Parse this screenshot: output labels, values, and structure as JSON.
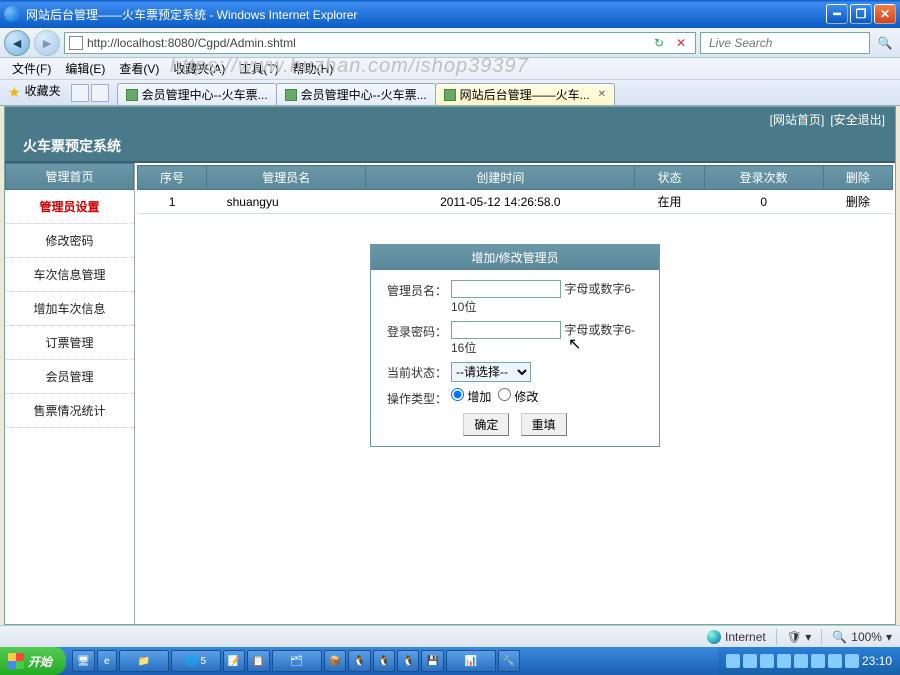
{
  "window": {
    "title": "网站后台管理——火车票预定系统 - Windows Internet Explorer"
  },
  "nav": {
    "url": "http://localhost:8080/Cgpd/Admin.shtml",
    "search_placeholder": "Live Search"
  },
  "menu": {
    "file": "文件(F)",
    "edit": "编辑(E)",
    "view": "查看(V)",
    "favorites": "收藏夹(A)",
    "tools": "工具(T)",
    "help": "帮助(H)"
  },
  "watermark": "https://www.huzhan.com/ishop39397",
  "favorites_label": "收藏夹",
  "tabs": [
    {
      "label": "会员管理中心--火车票..."
    },
    {
      "label": "会员管理中心--火车票..."
    },
    {
      "label": "网站后台管理——火车...",
      "active": true
    }
  ],
  "topbar": {
    "home": "[网站首页]",
    "logout": "[安全退出]"
  },
  "system_title": "火车票预定系统",
  "sidebar": {
    "header": "管理首页",
    "items": [
      {
        "label": "管理员设置",
        "active": true
      },
      {
        "label": "修改密码"
      },
      {
        "label": "车次信息管理"
      },
      {
        "label": "增加车次信息"
      },
      {
        "label": "订票管理"
      },
      {
        "label": "会员管理"
      },
      {
        "label": "售票情况统计"
      }
    ]
  },
  "grid": {
    "headers": {
      "seq": "序号",
      "user": "管理员名",
      "created": "创建时间",
      "status": "状态",
      "logins": "登录次数",
      "del": "删除"
    },
    "rows": [
      {
        "seq": "1",
        "user": "shuangyu",
        "created": "2011-05-12 14:26:58.0",
        "status": "在用",
        "logins": "0",
        "del": "删除"
      }
    ]
  },
  "form": {
    "title": "增加/修改管理员",
    "fields": {
      "username_label": "管理员名：",
      "username_hint": "字母或数字6-10位",
      "password_label": "登录密码：",
      "password_hint": "字母或数字6-16位",
      "status_label": "当前状态：",
      "status_option": "--请选择--",
      "optype_label": "操作类型：",
      "opt_add": "增加",
      "opt_edit": "修改"
    },
    "buttons": {
      "ok": "确定",
      "reset": "重填"
    }
  },
  "statusbar": {
    "zone": "Internet",
    "zoom": "100%"
  },
  "taskbar": {
    "start": "开始",
    "time": "23:10"
  }
}
